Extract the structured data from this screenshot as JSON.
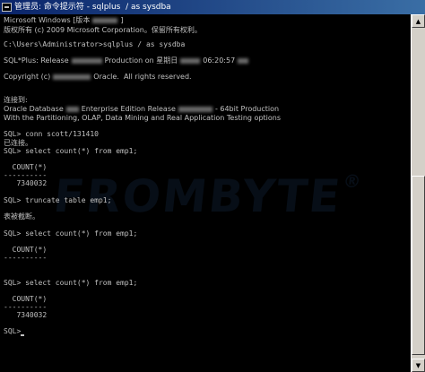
{
  "window": {
    "title": "管理员: 命令提示符 - sqlplus  / as sysdba"
  },
  "console": {
    "lines": [
      "Microsoft Windows [版本",
      "]",
      "版权所有 (c) 2009 Microsoft Corporation。保留所有权利。",
      "C:\\Users\\Administrator>sqlplus / as sysdba",
      "SQL*Plus: Release",
      "Production on 星期日",
      "06:20:57",
      "Copyright (c)",
      "Oracle.  All rights reserved.",
      "连接到:",
      "Oracle Database",
      "Enterprise Edition Release",
      "- 64bit Production",
      "With the Partitioning, OLAP, Data Mining and Real Application Testing options",
      "SQL> conn scott/131410",
      "已连接。",
      "SQL> select count(*) from emp1;",
      "  COUNT(*)",
      "----------",
      "   7340032",
      "SQL> truncate table emp1;",
      "表被截断。",
      "SQL> select count(*) from emp1;",
      "  COUNT(*)",
      "----------",
      "SQL> select count(*) from emp1;",
      "  COUNT(*)",
      "----------",
      "   7340032",
      "SQL>"
    ]
  },
  "watermark": {
    "text": "FROMBYTE",
    "mark": "®"
  },
  "icons": {
    "window_icon": "console-icon",
    "scroll_up": "arrow-up-icon",
    "scroll_down": "arrow-down-icon"
  },
  "colors": {
    "console_bg": "#000000",
    "console_text": "#c0c0c0",
    "titlebar": "#0a246a"
  }
}
